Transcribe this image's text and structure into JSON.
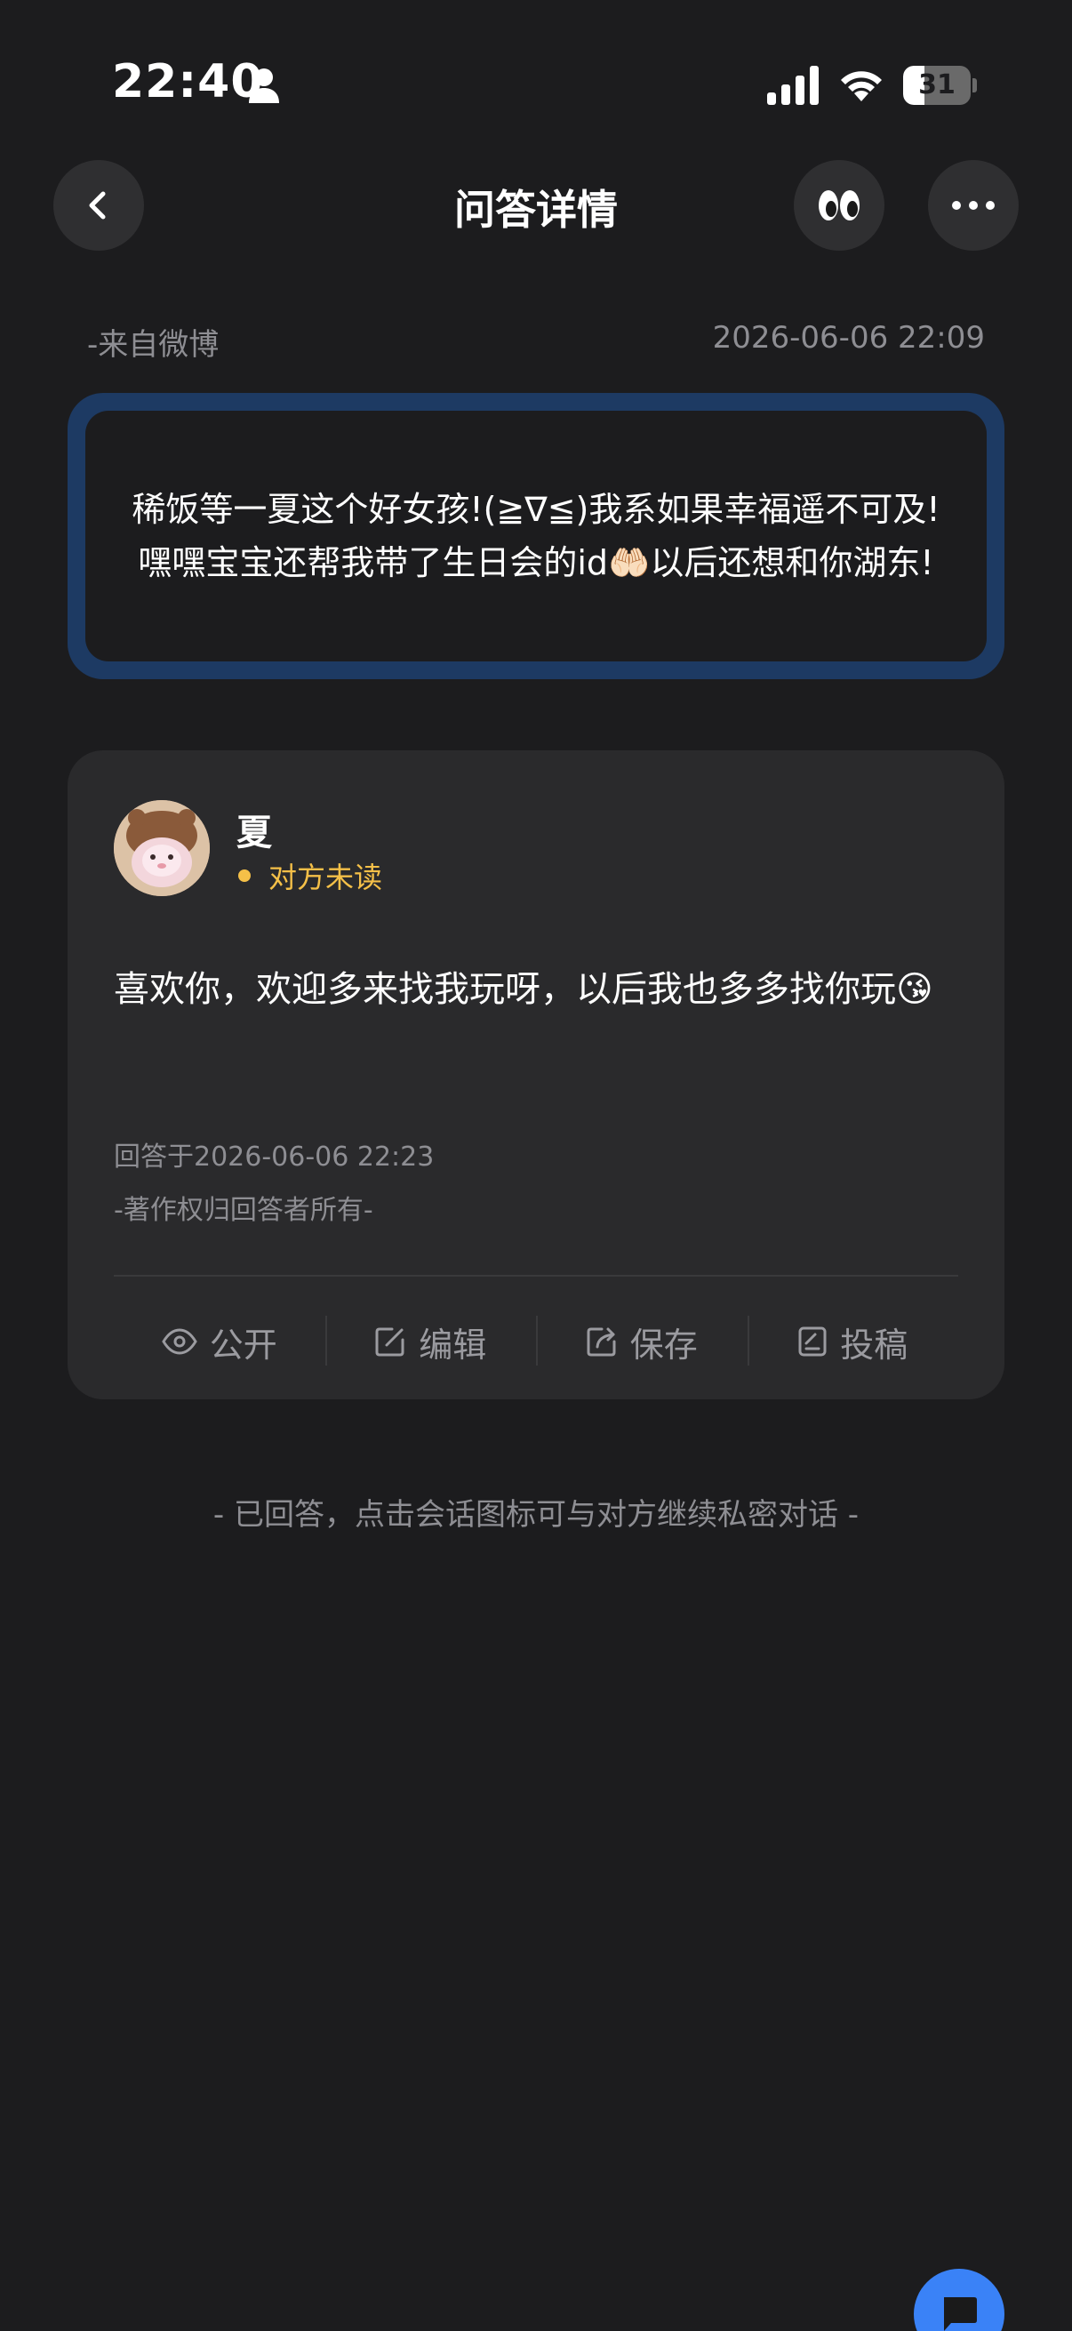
{
  "status_bar": {
    "time": "22:40",
    "battery": "31",
    "battery_level_percent": 31
  },
  "nav": {
    "title": "问答详情",
    "icons": [
      "chevron-left-icon",
      "eyes-emoji-icon",
      "more-dots-icon"
    ]
  },
  "question": {
    "source": "-来自微博",
    "time": "2026-06-06 22:09",
    "text": "稀饭等一夏这个好女孩!(≧∇≦)我系如果幸福遥不可及!嘿嘿宝宝还帮我带了生日会的id🤲🏻以后还想和你湖东!"
  },
  "answer": {
    "user_name": "夏",
    "status": "对方未读",
    "text": "喜欢你，欢迎多来找我玩呀，以后我也多多找你玩😘",
    "answered_at": "回答于2026-06-06 22:23",
    "copyright": "-著作权归回答者所有-"
  },
  "actions": [
    {
      "label": "公开",
      "icon": "eye-icon"
    },
    {
      "label": "编辑",
      "icon": "edit-icon"
    },
    {
      "label": "保存",
      "icon": "export-icon"
    },
    {
      "label": "投稿",
      "icon": "submit-icon"
    }
  ],
  "footer_hint": "- 已回答，点击会话图标可与对方继续私密对话 -",
  "colors": {
    "background": "#1c1c1e",
    "card": "#2a2a2c",
    "question_border": "#1d3a63",
    "unread": "#f5c048",
    "fab": "#3a82f7"
  }
}
